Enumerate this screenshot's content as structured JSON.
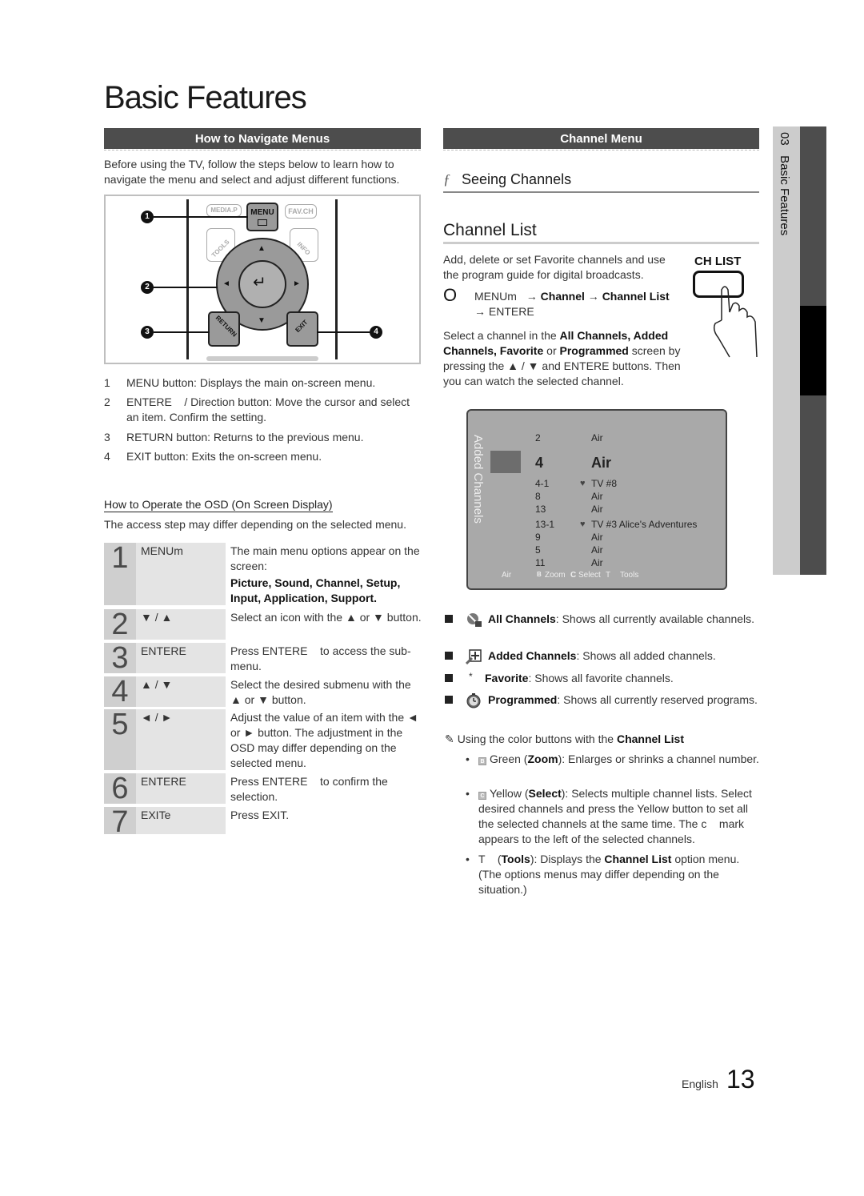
{
  "page_title": "Basic Features",
  "left": {
    "section_title": "How to Navigate Menus",
    "intro": "Before using the TV, follow the steps below to learn how to navigate the menu and select and adjust different functions.",
    "remote": {
      "buttons": {
        "media_p": "MEDIA.P",
        "menu": "MENU",
        "fav_ch": "FAV.CH",
        "tools": "TOOLS",
        "info": "INFO",
        "return": "RETURN",
        "exit": "EXIT"
      },
      "callouts": [
        "1",
        "2",
        "3",
        "4"
      ]
    },
    "numbered_items": [
      {
        "n": "1",
        "bold": "MENU",
        "text": " button: Displays the main on-screen menu."
      },
      {
        "n": "2",
        "bold": "ENTERE",
        "text": "    / Direction button: Move the cursor and select an item. Confirm the setting."
      },
      {
        "n": "3",
        "bold": "RETURN",
        "text": " button: Returns to the previous menu."
      },
      {
        "n": "4",
        "bold": "EXIT",
        "text": " button: Exits the on-screen menu."
      }
    ],
    "osd_heading": "How to Operate the OSD (On Screen Display)",
    "osd_note": "The access step may differ depending on the selected menu.",
    "steps": [
      {
        "n": "1",
        "key": "MENUm",
        "desc": "The main menu options appear on the screen:",
        "desc_bold": "Picture, Sound, Channel, Setup, Input, Application, Support."
      },
      {
        "n": "2",
        "key": "▼ / ▲",
        "desc": "Select an icon with the ▲ or ▼ button."
      },
      {
        "n": "3",
        "key": "ENTERE",
        "desc": "Press ENTERE    to access the sub-menu."
      },
      {
        "n": "4",
        "key": "▲ / ▼",
        "desc": "Select the desired submenu with the ▲ or ▼ button."
      },
      {
        "n": "5",
        "key": "◄ / ►",
        "desc": "Adjust the value of an item with the ◄ or ► button. The adjustment in the OSD may differ depending on the selected menu."
      },
      {
        "n": "6",
        "key": "ENTERE",
        "desc": "Press ENTERE    to confirm the selection."
      },
      {
        "n": "7",
        "key": "EXITe",
        "desc": "Press EXIT."
      }
    ]
  },
  "right": {
    "section_title": "Channel Menu",
    "seeing_symbol": "ƒ",
    "seeing_title": "Seeing Channels",
    "channel_list_title": "Channel List",
    "ch_list_button_label": "CH LIST",
    "intro": "Add, delete or set Favorite channels and use the program guide for digital broadcasts.",
    "path_symbol": "O",
    "path_menu": "MENUm",
    "path_arrow1": " → ",
    "path_channel": "Channel",
    "path_arrow2": " → ",
    "path_channel_list": "Channel List",
    "path_enter": "→ ENTERE",
    "select_text_1": "Select a channel in the ",
    "select_bold_1": "All Channels, Added Channels, Favorite",
    "select_text_2": " or ",
    "select_bold_2": "Programmed",
    "select_text_3": " screen by pressing the ▲ / ▼ and ENTERE buttons. Then you can watch the selected channel.",
    "tv_screen": {
      "vertical_label": "Added Channels",
      "channels": [
        {
          "num": "2",
          "fav": false,
          "name": "Air",
          "selected": false
        },
        {
          "num": "4",
          "fav": false,
          "name": "Air",
          "selected": true
        },
        {
          "num": "4-1",
          "fav": true,
          "name": "TV #8",
          "selected": false
        },
        {
          "num": "8",
          "fav": false,
          "name": "Air",
          "selected": false
        },
        {
          "num": "13",
          "fav": false,
          "name": "Air",
          "selected": false
        },
        {
          "num": "13-1",
          "fav": true,
          "name": "TV #3 Alice's Adventures",
          "selected": false
        },
        {
          "num": "9",
          "fav": false,
          "name": "Air",
          "selected": false
        },
        {
          "num": "5",
          "fav": false,
          "name": "Air",
          "selected": false
        },
        {
          "num": "11",
          "fav": false,
          "name": "Air",
          "selected": false
        }
      ],
      "footer": {
        "source": "Air",
        "zoom_key": "B",
        "zoom_label": "Zoom",
        "select_key": "C",
        "select_label": "Select",
        "tools_key": "T",
        "tools_label": "Tools"
      }
    },
    "list_modes": [
      {
        "icon": "all-channels-icon",
        "bold": "All Channels",
        "text": ": Shows all currently available channels."
      },
      {
        "icon": "added-channels-icon",
        "bold": "Added Channels",
        "text": ": Shows all added channels."
      },
      {
        "icon": "favorite-star-icon",
        "icon_char": "*",
        "bold": "Favorite",
        "text": ": Shows all favorite channels."
      },
      {
        "icon": "programmed-clock-icon",
        "bold": "Programmed",
        "text": ": Shows all currently reserved programs."
      }
    ],
    "note_text": "Using the color buttons with the ",
    "note_bold": "Channel List",
    "color_buttons": [
      {
        "key": "B",
        "pre": "Green (",
        "bold": "Zoom",
        "text": "): Enlarges or shrinks a channel number."
      },
      {
        "key": "C",
        "pre": "Yellow (",
        "bold": "Select",
        "text": "): Selects multiple channel lists. Select desired channels and press the Yellow button to set all the selected channels at the same time. The c    mark appears to the left of the selected channels."
      },
      {
        "key": "",
        "pre": "T    (",
        "bold": "Tools",
        "text": "): Displays the ",
        "bold2": "Channel List",
        "text2": " option menu. (The options menus may differ depending on the situation.)"
      }
    ]
  },
  "side_tab": {
    "label": "03   Basic Features"
  },
  "footer": {
    "language": "English",
    "page_number": "13"
  }
}
